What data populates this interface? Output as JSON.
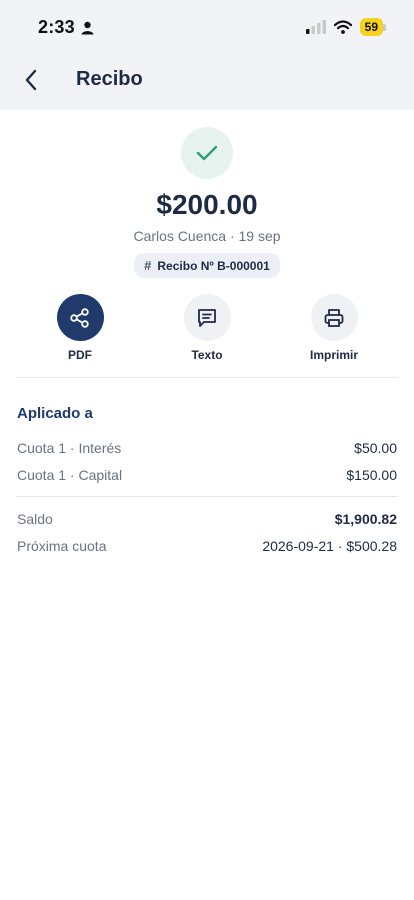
{
  "status_bar": {
    "time": "2:33",
    "battery": "59"
  },
  "header": {
    "title": "Recibo"
  },
  "receipt": {
    "amount": "$200.00",
    "meta": "Carlos Cuenca · 19 sep",
    "number": "Recibo Nº B-000001"
  },
  "actions": [
    {
      "label": "PDF",
      "icon": "share-icon"
    },
    {
      "label": "Texto",
      "icon": "message-icon"
    },
    {
      "label": "Imprimir",
      "icon": "printer-icon"
    }
  ],
  "applied": {
    "title": "Aplicado a",
    "rows": [
      {
        "label": "Cuota 1 · Interés",
        "value": "$50.00"
      },
      {
        "label": "Cuota 1 · Capital",
        "value": "$150.00"
      }
    ]
  },
  "summary": {
    "rows": [
      {
        "label": "Saldo",
        "value": "$1,900.82"
      },
      {
        "label": "Próxima cuota",
        "value": "2026-09-21 · $500.28"
      }
    ]
  },
  "colors": {
    "primary": "#1f3a6b",
    "success": "#2f9e7a",
    "battery": "#f6d21f"
  }
}
